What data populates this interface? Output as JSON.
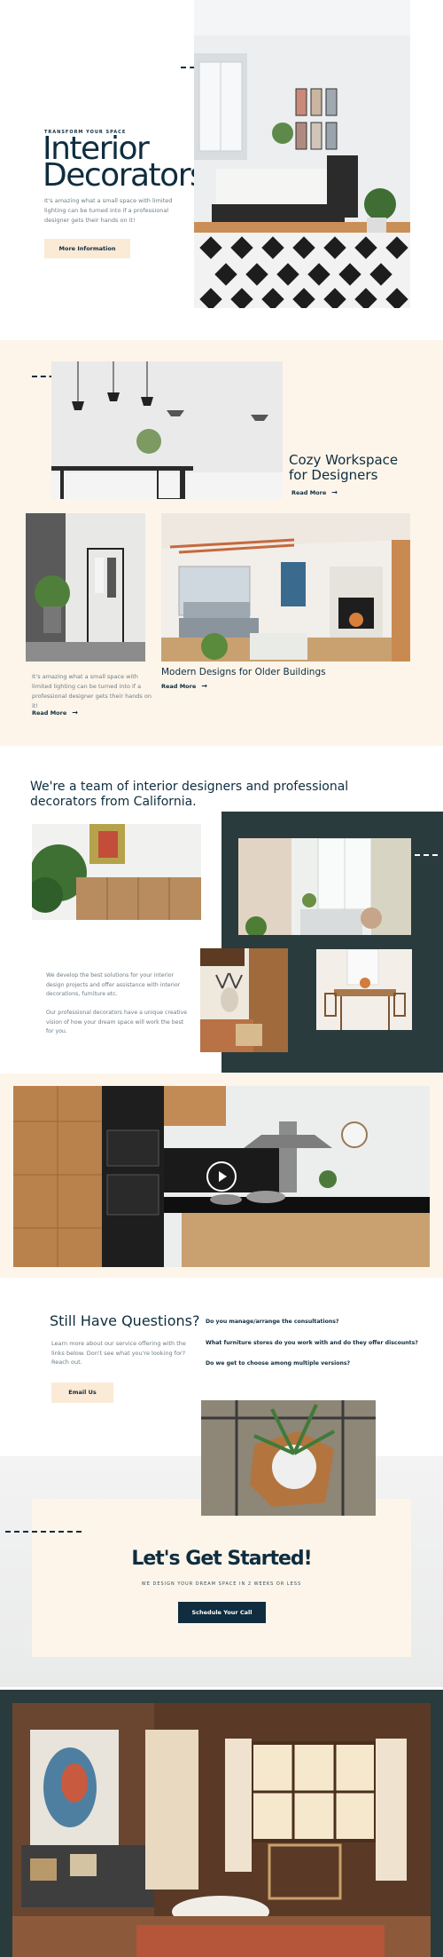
{
  "hero": {
    "eyebrow": "TRANSFORM YOUR SPACE",
    "title_line1": "Interior",
    "title_line2": "Decorators",
    "description": "It's amazing what a small space with limited lighting can be turned into if a professional designer gets their hands on it!",
    "button": "More Information"
  },
  "features": {
    "cozy_title_line1": "Cozy Workspace",
    "cozy_title_line2": "for Designers",
    "cozy_link": "Read More",
    "left_text": "It's amazing what a small space with limited lighting can be turned into if a professional designer gets their hands on it!",
    "left_link": "Read More",
    "modern_title": "Modern Designs for Older Buildings",
    "modern_link": "Read More"
  },
  "team": {
    "heading_line1": "We're a team of interior designers and professional",
    "heading_line2": "decorators from California.",
    "para1": "We develop the best solutions for your interior design projects and offer assistance with interior decorations, furniture etc.",
    "para2": "Our professional decorators have a unique creative vision of how your dream space will work the best for you."
  },
  "questions": {
    "title": "Still Have Questions?",
    "description": "Learn more about our service offering with the links below. Don't see what you're looking for? Reach out.",
    "button": "Email Us",
    "q1": "Do you manage/arrange the consultations?",
    "q2": "What furniture stores do you work with and do they offer discounts?",
    "q3": "Do we get to choose among multiple versions?"
  },
  "cta": {
    "title": "Let's Get Started!",
    "subtitle": "WE DESIGN YOUR DREAM SPACE IN 2 WEEKS OR LESS",
    "button": "Schedule Your Call"
  },
  "video": {
    "play_icon": "play-icon"
  },
  "colors": {
    "navy": "#0f2d3f",
    "cream": "#fdf5ea",
    "dark_panel": "#2a3b3d",
    "button_cream": "#fbead6"
  }
}
